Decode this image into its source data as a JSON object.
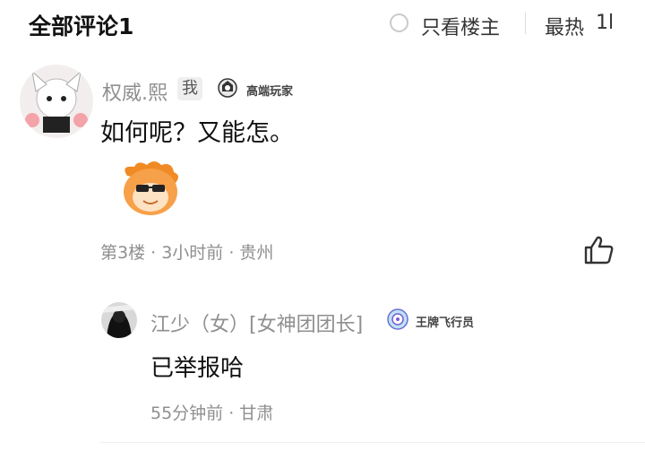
{
  "header": {
    "title": "全部评论1",
    "only_host": "只看楼主",
    "sort": "最热",
    "sort_icon": "1l"
  },
  "comment": {
    "author": "权威.熙",
    "me_badge": "我",
    "level_badge": "高端玩家",
    "content": "如何呢？又能怎。",
    "meta": "第3楼 · 3小时前 · 贵州"
  },
  "reply": {
    "author": "江少（女）[女神团团长]",
    "level_badge": "王牌飞行员",
    "content": "已举报哈",
    "meta": "55分钟前 · 甘肃"
  },
  "icons": {
    "radio": "radio-circle-icon",
    "sort": "sort-icon",
    "like": "thumbs-up-icon",
    "sticker": "emoji-sticker-icon"
  }
}
